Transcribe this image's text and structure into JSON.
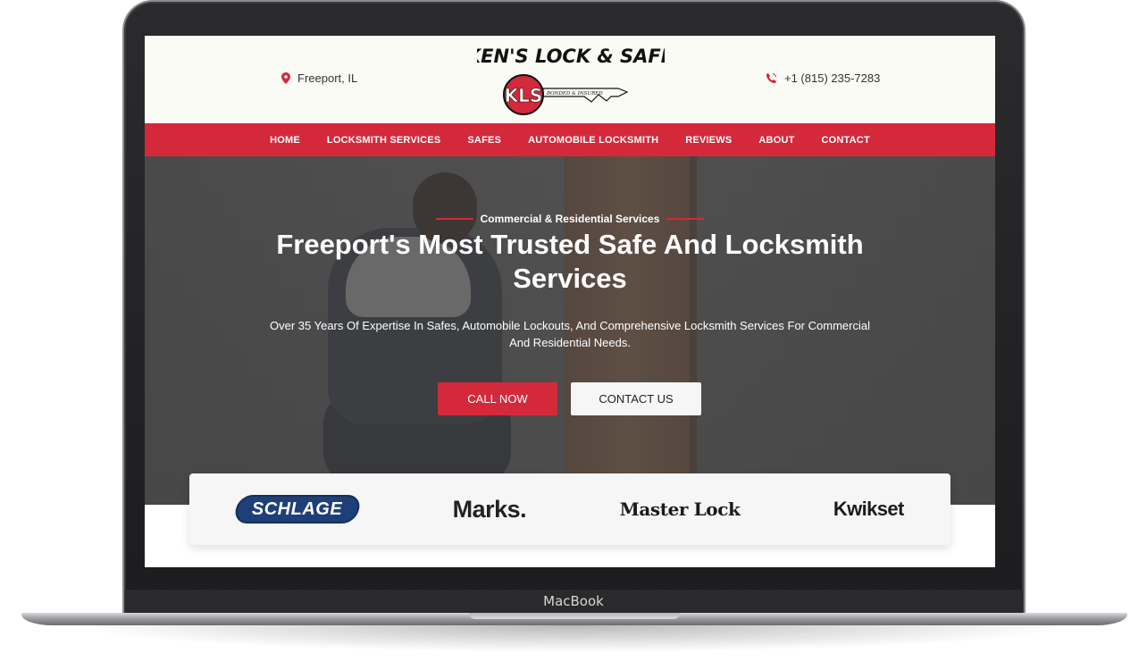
{
  "device": {
    "label": "MacBook"
  },
  "header": {
    "location": "Freeport, IL",
    "phone": "+1 (815) 235-7283",
    "logo_text": "KEN'S LOCK & SAFE",
    "logo_monogram": "KLS",
    "logo_tagline": "BONDED & INSURED"
  },
  "nav": {
    "items": [
      "HOME",
      "LOCKSMITH SERVICES",
      "SAFES",
      "AUTOMOBILE LOCKSMITH",
      "REVIEWS",
      "ABOUT",
      "CONTACT"
    ]
  },
  "hero": {
    "eyebrow": "Commercial & Residential Services",
    "title": "Freeport's Most Trusted Safe And Locksmith Services",
    "subtitle": "Over 35 Years Of Expertise In Safes, Automobile Lockouts, And Comprehensive Locksmith Services For Commercial And Residential Needs.",
    "call_label": "CALL NOW",
    "contact_label": "CONTACT US"
  },
  "brands": [
    "SCHLAGE",
    "Marks.",
    "Master Lock",
    "Kwikset"
  ],
  "colors": {
    "accent": "#d4293b",
    "nav_bg": "#d4293b",
    "header_bg": "#fbfbf6"
  },
  "icons": {
    "location": "map-pin-icon",
    "phone": "phone-icon"
  }
}
